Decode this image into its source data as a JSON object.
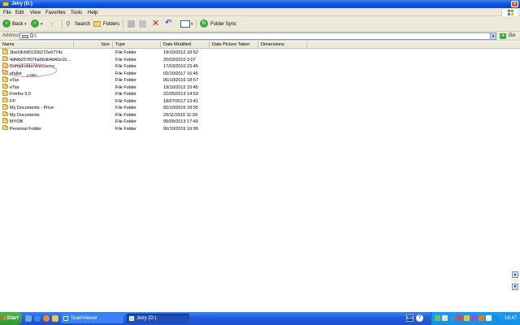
{
  "window": {
    "title": "Jelry (D:)"
  },
  "menu": [
    "File",
    "Edit",
    "View",
    "Favorites",
    "Tools",
    "Help"
  ],
  "toolbar": {
    "back": "Back",
    "search": "Search",
    "folders": "Folders",
    "folder_sync": "Folder Sync"
  },
  "address": {
    "label": "Address",
    "value": "D:\\",
    "go": "Go"
  },
  "columns": {
    "name": "Name",
    "size": "Size",
    "type": "Type",
    "date_modified": "Date Modified",
    "date_picture_taken": "Date Picture Taken",
    "dimensions": "Dimensions"
  },
  "files": [
    {
      "name": "2be18cfd01336272e6774c",
      "type": "File Folder",
      "date": "19/10/2012 10:52"
    },
    {
      "name": "4dfdb257f076a66d04d42e16...",
      "type": "File Folder",
      "date": "20/03/2010 3:07"
    },
    {
      "name": "DumpFolder\\Recovery",
      "type": "File Folder",
      "date": "17/03/2010 23:45"
    },
    {
      "name": "efallot",
      "type": "File Folder",
      "date": "02/10/2017 16:45"
    },
    {
      "name": "eTax",
      "type": "File Folder",
      "date": "05/10/2016 18:57"
    },
    {
      "name": "eTax",
      "type": "File Folder",
      "date": "19/10/2012 10:45"
    },
    {
      "name": "Firefox 5.0",
      "type": "File Folder",
      "date": "22/05/2013 14:53"
    },
    {
      "name": "FP",
      "type": "File Folder",
      "date": "18/07/2017 13:41"
    },
    {
      "name": "My Documents - Prive",
      "type": "File Folder",
      "date": "05/10/2016 18:55"
    },
    {
      "name": "My Documents",
      "type": "File Folder",
      "date": "29/11/2016 11:39"
    },
    {
      "name": "MYOB",
      "type": "File Folder",
      "date": "05/09/2013 17:49"
    },
    {
      "name": "Personal Folder",
      "type": "File Folder",
      "date": "06/10/2016 10:09"
    }
  ],
  "annotation": {
    "text": "LAMA"
  },
  "taskbar": {
    "start": "Start",
    "tasks": [
      "TeamViewer",
      "Jelry (D:)"
    ],
    "lang": "EN",
    "clock": "16:47"
  },
  "colors": {
    "titlebar": "#0a4fd8",
    "chrome": "#ece9d8",
    "taskbar": "#245edb",
    "start": "#2f962f",
    "annotation": "#e88cb0"
  }
}
